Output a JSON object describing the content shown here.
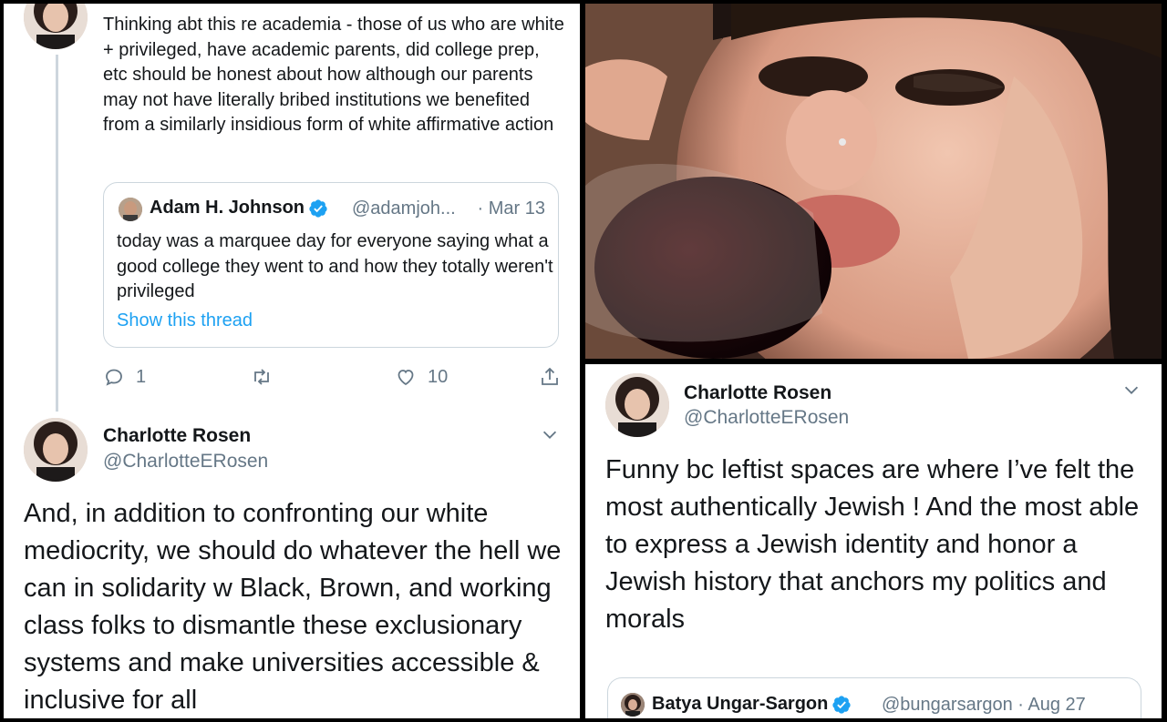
{
  "left": {
    "tweet_text": "Thinking abt this re academia - those of us who are white + privileged, have academic parents, did college prep, etc should be honest about how although our parents may not have literally bribed institutions we benefited from a similarly insidious form of white affirmative action",
    "quote": {
      "name": "Adam H. Johnson",
      "handle": "@adamjoh...",
      "date": "· Mar 13",
      "text": "today was a marquee day for everyone saying what a good college they went to and how they totally weren't privileged",
      "link": "Show this thread"
    },
    "actions": {
      "reply_count": "1",
      "retweet_count": "",
      "like_count": "10"
    },
    "second_tweet": {
      "name": "Charlotte Rosen",
      "handle": "@CharlotteERosen",
      "text": "And, in addition to confronting our white mediocrity, we should do whatever the hell we can in solidarity w Black, Brown, and working class folks to dismantle these exclusionary systems and make universities accessible & inclusive for all"
    }
  },
  "right": {
    "name": "Charlotte Rosen",
    "handle": "@CharlotteERosen",
    "text": "Funny bc leftist spaces are where I’ve felt the most authentically Jewish ! And the most able to express a Jewish identity and honor a Jewish history that anchors my politics and morals",
    "quote": {
      "name": "Batya Ungar-Sargon",
      "handle": "@bungarsargon · Aug 27"
    }
  },
  "colors": {
    "accent": "#1da1f2",
    "secondary_text": "#657786",
    "border": "#ccd6dd"
  }
}
